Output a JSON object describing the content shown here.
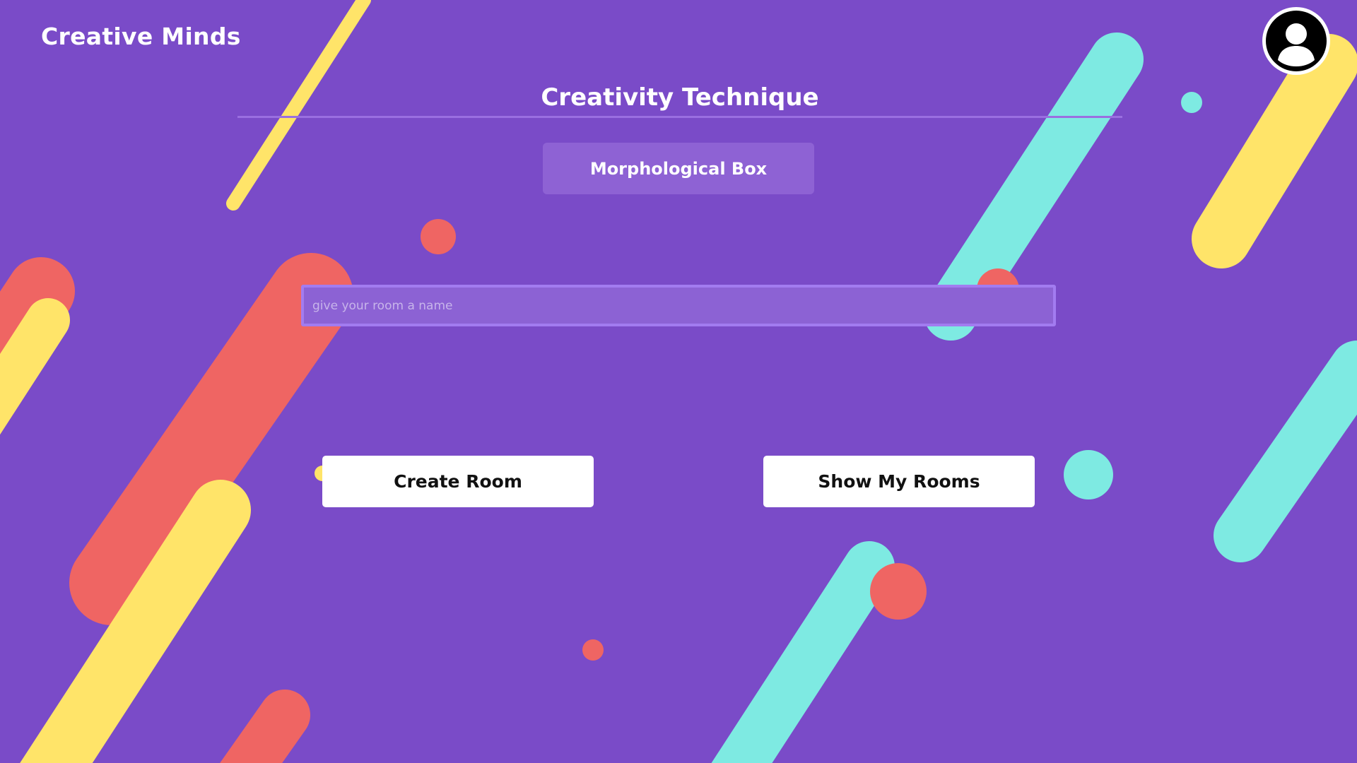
{
  "app": {
    "brand": "Creative Minds"
  },
  "form": {
    "section_title": "Creativity Technique",
    "technique_label": "Morphological Box",
    "room_name_placeholder": "give your room a name",
    "room_name_value": ""
  },
  "actions": {
    "create_room_label": "Create Room",
    "show_rooms_label": "Show My Rooms"
  },
  "icons": {
    "profile": "user-avatar-icon"
  },
  "colors": {
    "background": "#7a4bc8",
    "accent_red": "#ef6563",
    "accent_yellow": "#ffe469",
    "accent_cyan": "#7eeae2",
    "button_bg": "#ffffff",
    "technique_button_bg": "#8e62d4"
  }
}
